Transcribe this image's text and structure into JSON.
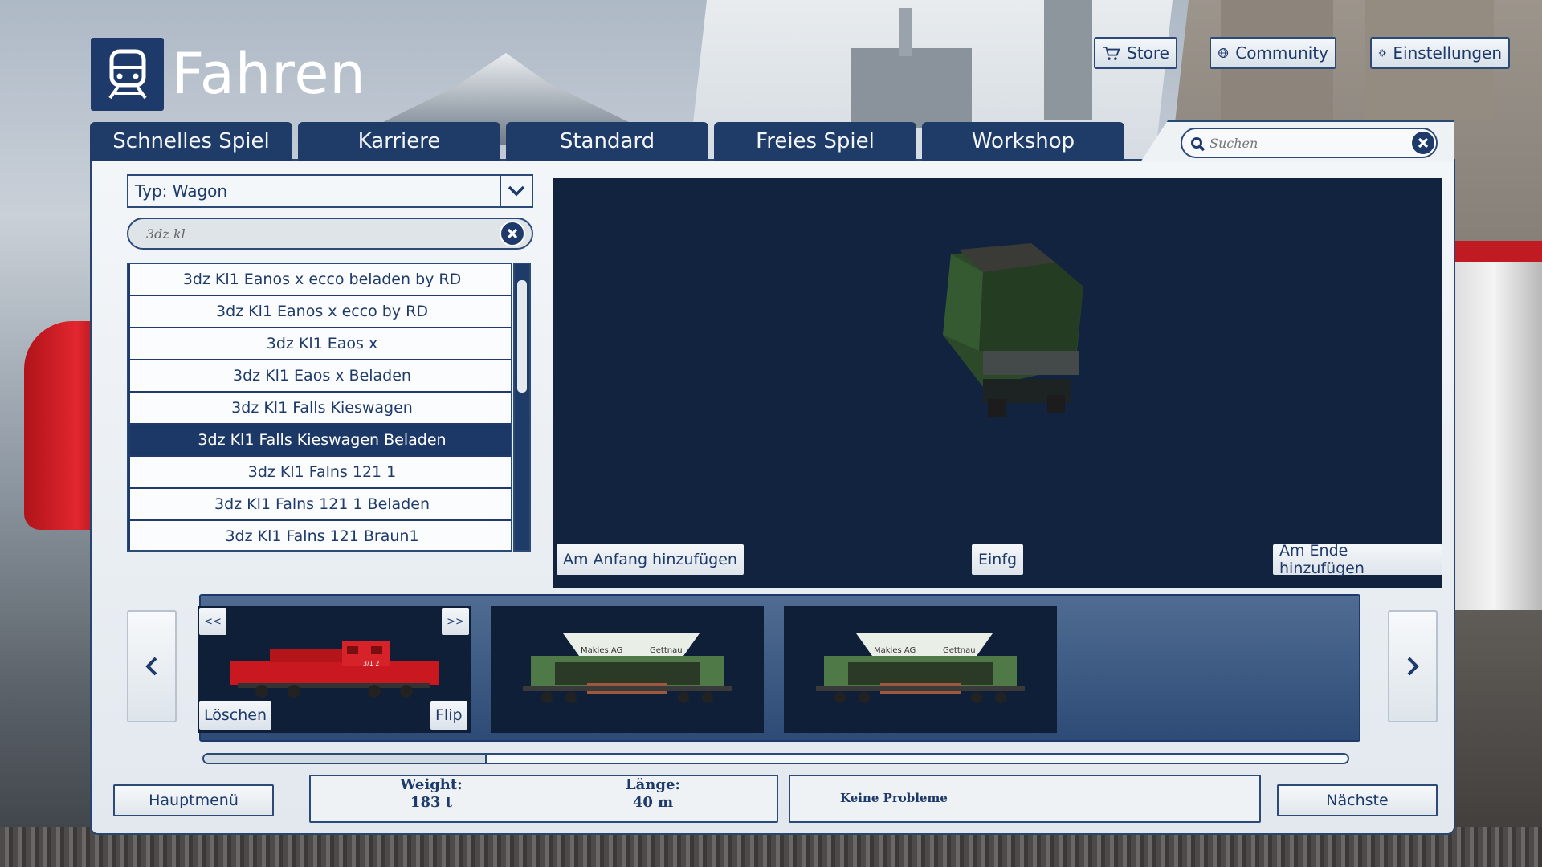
{
  "app": {
    "title": "Fahren"
  },
  "top_buttons": {
    "store": "Store",
    "community": "Community",
    "settings": "Einstellungen"
  },
  "tabs": [
    "Schnelles Spiel",
    "Karriere",
    "Standard",
    "Freies Spiel",
    "Workshop"
  ],
  "search": {
    "placeholder": "Suchen"
  },
  "filter": {
    "type_value": "Typ: Wagon",
    "search_value": "3dz kl"
  },
  "list": {
    "items": [
      "3dz Kl1 Eanos x ecco beladen by RD",
      "3dz Kl1 Eanos x ecco by RD",
      "3dz Kl1 Eaos x",
      "3dz Kl1 Eaos x Beladen",
      "3dz Kl1 Falls Kieswagen",
      "3dz Kl1 Falls Kieswagen Beladen",
      "3dz Kl1 Falns 121 1",
      "3dz Kl1 Falns 121 1 Beladen",
      "3dz Kl1 Falns 121 Braun1"
    ],
    "selected_index": 5
  },
  "preview": {
    "add_start": "Am Anfang hinzufügen",
    "insert": "Einfg",
    "add_end": "Am Ende hinzufügen"
  },
  "consist": {
    "prev_small": "<<",
    "next_small": ">>",
    "delete": "Löschen",
    "flip": "Flip",
    "wagon_label_left": "Makies AG",
    "wagon_label_right": "Gettnau",
    "loco_number": "3/1 2"
  },
  "footer": {
    "main_menu": "Hauptmenü",
    "weight_label": "Weight:",
    "weight_value": "183 t",
    "length_label": "Länge:",
    "length_value": "40 m",
    "status": "Keine Probleme",
    "next": "Nächste"
  },
  "colors": {
    "navy": "#1e3a6a",
    "panel": "#eef2f5",
    "preview_bg": "#122340"
  }
}
